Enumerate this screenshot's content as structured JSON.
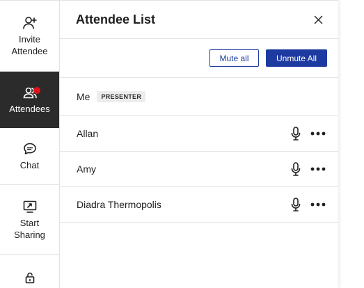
{
  "rail": {
    "items": [
      {
        "id": "invite",
        "label_line1": "Invite",
        "label_line2": "Attendee"
      },
      {
        "id": "attendees",
        "label_line1": "Attendees",
        "label_line2": ""
      },
      {
        "id": "chat",
        "label_line1": "Chat",
        "label_line2": ""
      },
      {
        "id": "share",
        "label_line1": "Start",
        "label_line2": "Sharing"
      }
    ]
  },
  "panel": {
    "title": "Attendee List",
    "mute_all_label": "Mute all",
    "unmute_all_label": "Unmute All",
    "me": {
      "name": "Me",
      "tag": "PRESENTER"
    },
    "attendees": [
      {
        "name": "Allan"
      },
      {
        "name": "Amy"
      },
      {
        "name": "Diadra Thermopolis"
      }
    ]
  },
  "colors": {
    "accent": "#1c3aa0",
    "active_rail_bg": "#2b2b2b",
    "notification_dot": "#e0121c"
  },
  "icons": {
    "invite": "add-person-icon",
    "attendees": "people-icon",
    "chat": "chat-bubble-icon",
    "share": "screen-share-icon",
    "lock": "lock-icon",
    "close": "close-icon",
    "mic": "microphone-icon",
    "more": "more-horizontal-icon"
  }
}
